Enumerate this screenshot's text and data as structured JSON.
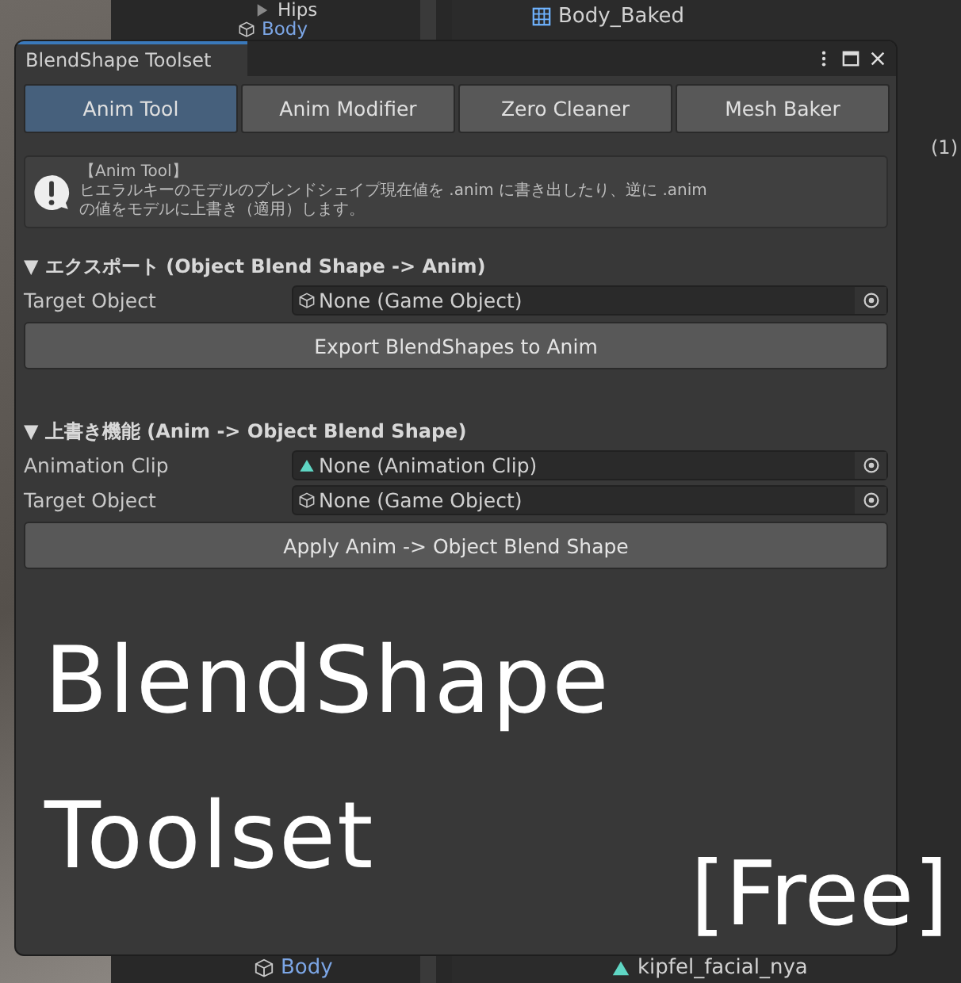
{
  "editor": {
    "hierarchy_top": [
      {
        "label": "Hips",
        "kind": "bone"
      },
      {
        "label": "Body",
        "kind": "mesh"
      }
    ],
    "hierarchy_bottom": [
      {
        "label": "Body",
        "kind": "mesh"
      }
    ],
    "project_top": [
      {
        "label": "Body_Baked",
        "kind": "mesh"
      }
    ],
    "project_bottom": [
      {
        "label": "kipfel_facial_nya",
        "kind": "clip"
      }
    ],
    "project_count": "(1)"
  },
  "window": {
    "title": "BlendShape Toolset",
    "tabs": [
      {
        "label": "Anim Tool",
        "selected": true
      },
      {
        "label": "Anim Modifier",
        "selected": false
      },
      {
        "label": "Zero Cleaner",
        "selected": false
      },
      {
        "label": "Mesh Baker",
        "selected": false
      }
    ],
    "help_box": {
      "title": "【Anim Tool】",
      "text": "ヒエラルキーのモデルのブレンドシェイプ現在値を .anim に書き出したり、逆に .anim\nの値をモデルに上書き（適用）します。"
    },
    "sections": [
      {
        "header": "▼ エクスポート (Object Blend Shape -> Anim)",
        "fields": [
          {
            "label": "Target Object",
            "value": "None (Game Object)",
            "kind": "object"
          }
        ],
        "button": "Export BlendShapes to Anim"
      },
      {
        "header": "▼ 上書き機能 (Anim -> Object Blend Shape)",
        "fields": [
          {
            "label": "Animation Clip",
            "value": "None (Animation Clip)",
            "kind": "clip"
          },
          {
            "label": "Target Object",
            "value": "None (Game Object)",
            "kind": "object"
          }
        ],
        "button": "Apply Anim -> Object Blend Shape"
      }
    ]
  },
  "overlay": {
    "lines": [
      "BlendShape",
      "Toolset"
    ],
    "badge": "[Free]"
  }
}
